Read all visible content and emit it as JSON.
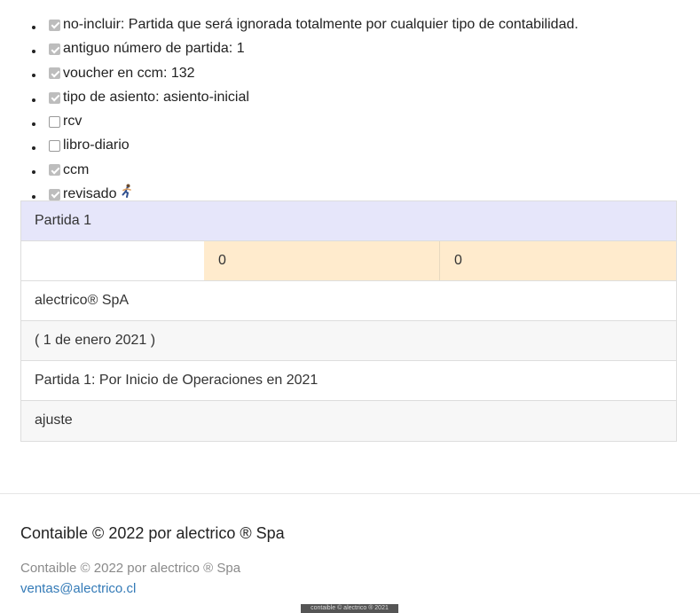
{
  "attributes": [
    {
      "checked": true,
      "label": "no-incluir: Partida que será ignorada totalmente por cualquier tipo de contabilidad."
    },
    {
      "checked": true,
      "label": "antiguo número de partida: 1"
    },
    {
      "checked": true,
      "label": "voucher en ccm: 132"
    },
    {
      "checked": true,
      "label": "tipo de asiento: asiento-inicial"
    },
    {
      "checked": false,
      "label": "rcv"
    },
    {
      "checked": false,
      "label": "libro-diario"
    },
    {
      "checked": true,
      "label": "ccm"
    },
    {
      "checked": true,
      "label": "revisado",
      "icon": "runner-icon"
    }
  ],
  "entry": {
    "title": "Partida 1",
    "debit": "0",
    "credit": "0",
    "company": "alectrico® SpA",
    "date": "( 1 de enero 2021 )",
    "description": "Partida 1: Por Inicio de Operaciones en 2021",
    "type": "ajuste"
  },
  "colors": {
    "heading_bg": "#e6e6fa",
    "amount_bg": "#ffebcd",
    "link": "#337ab7"
  },
  "footer": {
    "title": "Contaible © 2022 por alectrico ® Spa",
    "subtitle": "Contaible © 2022 por alectrico ® Spa",
    "email": "ventas@alectrico.cl",
    "badge": "contaible © alectrico ® 2021"
  }
}
